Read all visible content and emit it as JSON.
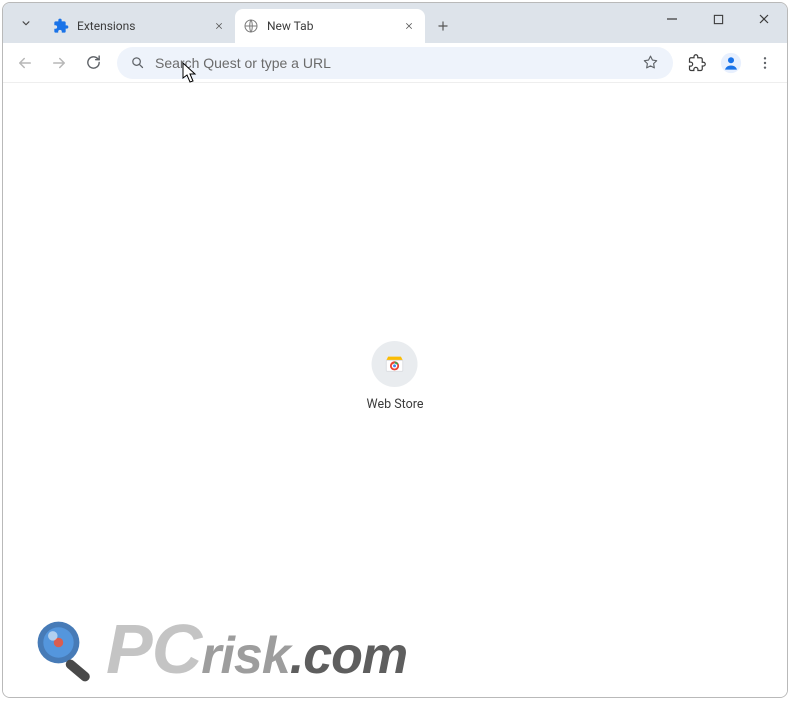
{
  "tabs": [
    {
      "title": "Extensions"
    },
    {
      "title": "New Tab"
    }
  ],
  "omnibox": {
    "placeholder": "Search Quest or type a URL"
  },
  "shortcut": {
    "label": "Web Store"
  },
  "watermark": {
    "seg1": "PC",
    "seg2": "risk",
    "seg3": ".com"
  }
}
